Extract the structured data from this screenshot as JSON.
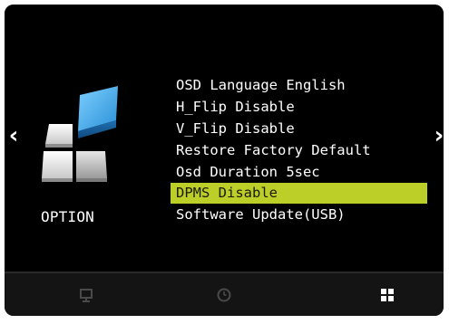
{
  "osd": {
    "category": {
      "label": "OPTION",
      "icon": "option-tiles-icon"
    },
    "menu_items": [
      {
        "label": "OSD Language  English",
        "selected": false
      },
      {
        "label": "H_Flip Disable",
        "selected": false
      },
      {
        "label": "V_Flip Disable",
        "selected": false
      },
      {
        "label": "Restore Factory Default",
        "selected": false
      },
      {
        "label": "Osd Duration 5sec",
        "selected": false
      },
      {
        "label": "DPMS Disable",
        "selected": true
      },
      {
        "label": "Software Update(USB)",
        "selected": false
      }
    ],
    "nav": {
      "left_arrow": "‹",
      "right_arrow": "›"
    },
    "bottom_tabs": [
      {
        "icon": "display-icon",
        "active": false
      },
      {
        "icon": "clock-icon",
        "active": false
      },
      {
        "icon": "option-grid-icon",
        "active": true
      }
    ],
    "colors": {
      "background": "#000000",
      "highlight": "#bccf29",
      "text": "#ffffff",
      "inactive_icon": "#4a4a4a",
      "active_icon": "#ffffff",
      "tile_blue": "#3a9ee0"
    }
  }
}
